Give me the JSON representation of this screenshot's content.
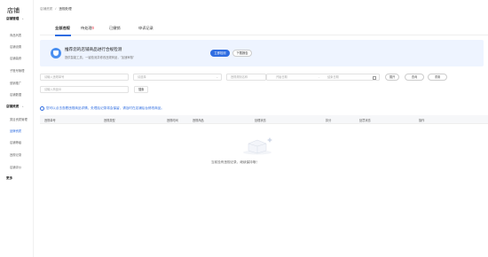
{
  "sidebar": {
    "brand": "店铺",
    "groups": [
      {
        "label": "店铺管理",
        "items": [
          "商品列表",
          "店铺设置",
          "店铺装修",
          "子账号管理",
          "营销推广",
          "店铺数据"
        ]
      },
      {
        "label": "店铺资质",
        "items": [
          "类目资质管理",
          "品牌资质",
          "店铺等级"
        ],
        "active": 1
      },
      {
        "label": "违规记录",
        "items": [
          "店铺评价"
        ]
      }
    ],
    "last_group": "更多"
  },
  "breadcrumb": {
    "parent": "店铺资质",
    "sep": "/",
    "current": "违规处理"
  },
  "tabs": [
    {
      "label": "全部违规"
    },
    {
      "label": "待处理",
      "count": "0"
    },
    {
      "label": "已撤销"
    },
    {
      "label": "申诉记录"
    }
  ],
  "banner": {
    "title": "推荐您的店铺商品进行合规检测",
    "subtitle": "提供智能工具，一键检测并修改违规商品，\"加速审核\"",
    "primary_btn": "立即检测",
    "secondary_btn": "下载报告"
  },
  "filters": {
    "order_no": "请输入违规单号",
    "type_select": "请选择",
    "rule_name": "违规规则名称",
    "date_start": "开始日期",
    "date_sep": "-",
    "date_end": "结束日期",
    "btn_expand": "展开",
    "btn_query": "查询",
    "btn_reset": "重置",
    "product_id": "请输入商品ID",
    "btn_search": "搜索"
  },
  "notice": "您可以点击查看违规商品详情，处理后记录将会保留，请及时在店铺后台修改商品。",
  "table": {
    "columns": [
      "违规单号",
      "违规类型",
      "违规时间",
      "违规商品",
      "处理状态",
      "扣分",
      "处罚状态",
      "操作"
    ]
  },
  "empty_text": "当前没有违规记录，继续保持哦！",
  "colors": {
    "accent": "#2f6de1",
    "banner_bg": "#eef4ff"
  }
}
